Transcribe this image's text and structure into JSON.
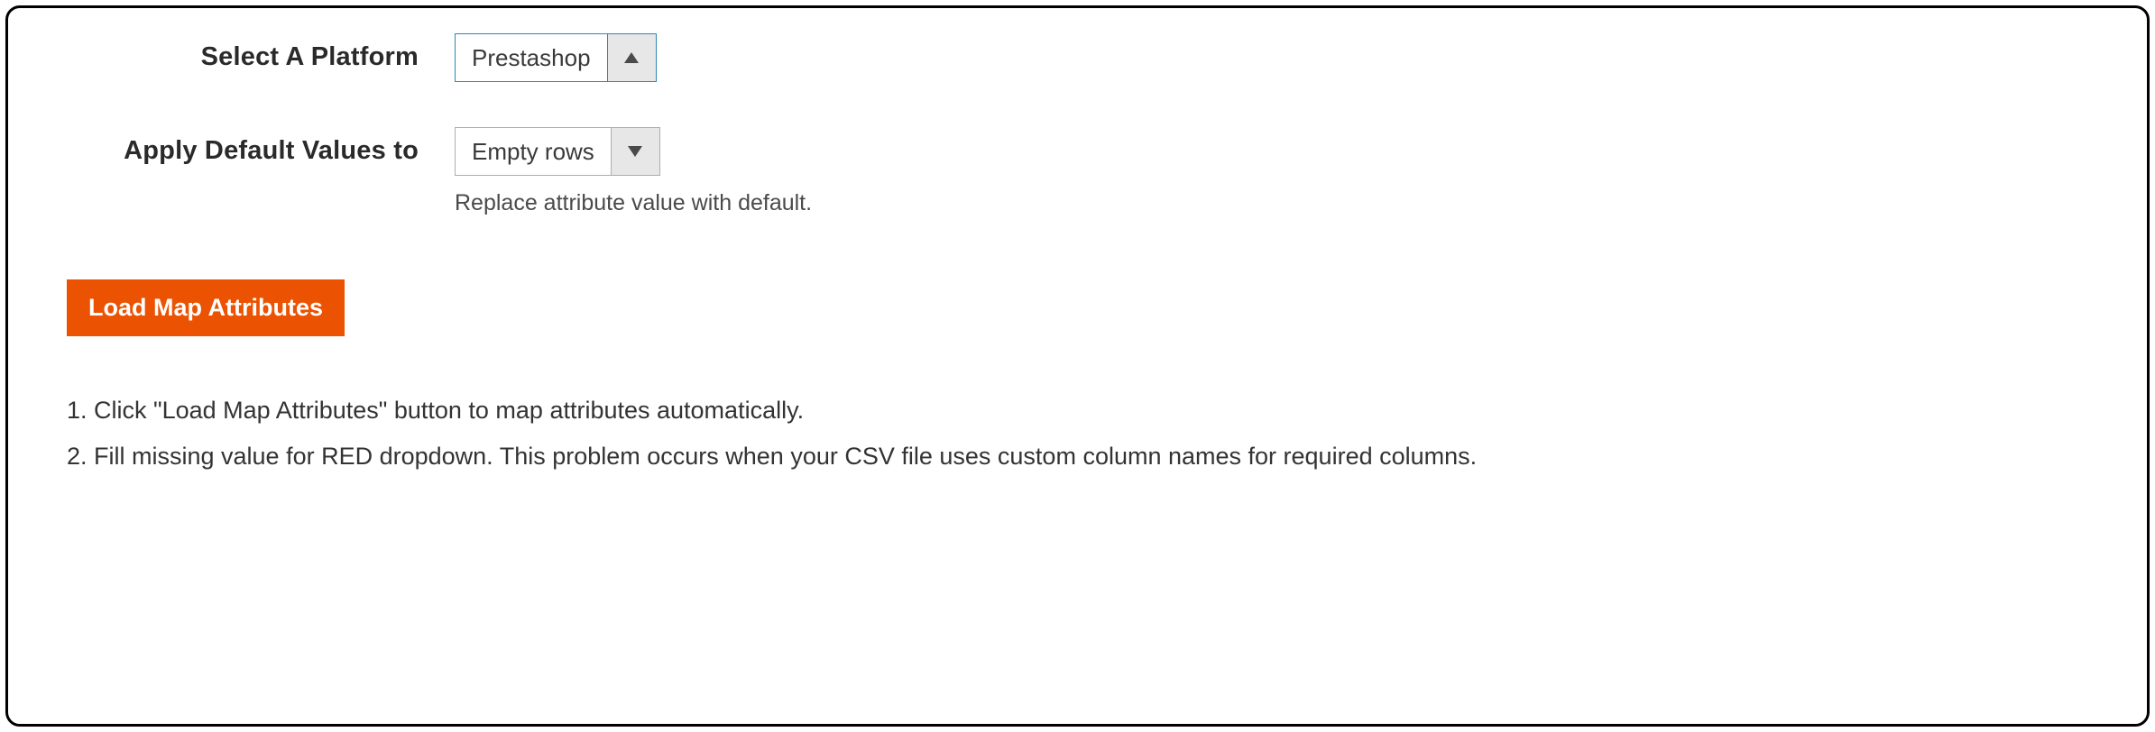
{
  "form": {
    "platform": {
      "label": "Select A Platform",
      "value": "Prestashop"
    },
    "defaultValues": {
      "label": "Apply Default Values to",
      "value": "Empty rows",
      "helper": "Replace attribute value with default."
    }
  },
  "actions": {
    "loadMapAttributes": "Load Map Attributes"
  },
  "instructions": {
    "line1": "1. Click \"Load Map Attributes\" button to map attributes automatically.",
    "line2": "2. Fill missing value for RED dropdown. This problem occurs when your CSV file uses custom column names for required columns."
  }
}
